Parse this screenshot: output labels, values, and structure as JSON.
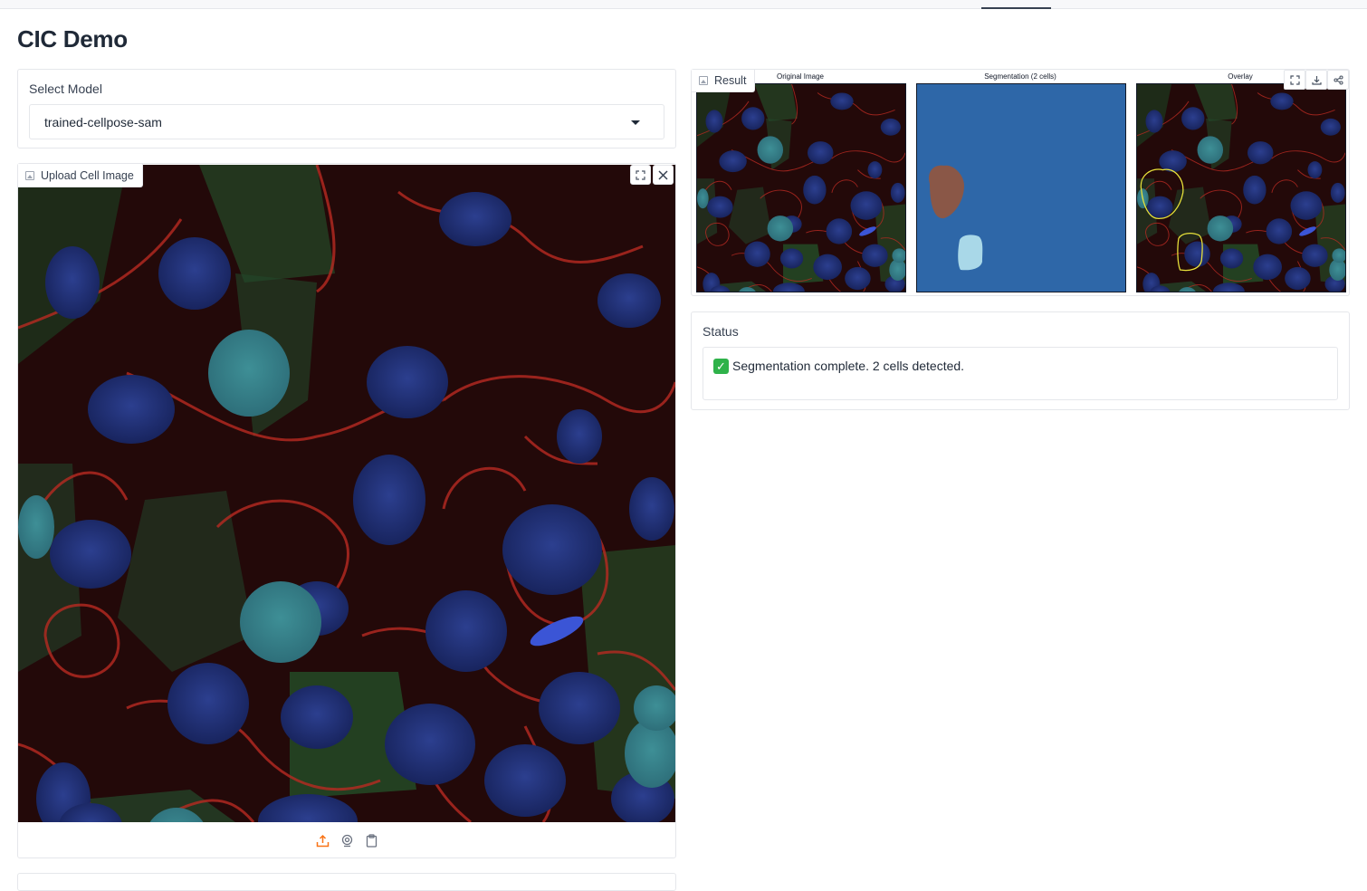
{
  "page": {
    "title": "CIC Demo"
  },
  "model": {
    "label": "Select Model",
    "selected": "trained-cellpose-sam"
  },
  "upload": {
    "label": "Upload Cell Image",
    "icons": [
      "image-icon",
      "fullscreen-icon",
      "close-icon",
      "upload-icon",
      "webcam-icon",
      "clipboard-icon"
    ]
  },
  "result": {
    "label": "Result",
    "panels": [
      {
        "title": "Original Image"
      },
      {
        "title": "Segmentation (2 cells)"
      },
      {
        "title": "Overlay"
      }
    ],
    "icons": [
      "fullscreen-icon",
      "download-icon",
      "share-icon"
    ]
  },
  "status": {
    "label": "Status",
    "text": "Segmentation complete. 2 cells detected.",
    "check_icon": "check-icon",
    "check_color": "#2fb24a"
  },
  "colors": {
    "accent": "#f97316",
    "seg_background": "#2e67a8",
    "seg_cell_1": "#8a5747",
    "seg_cell_2": "#a9d8e8",
    "overlay_outline": "#e8e23a"
  }
}
